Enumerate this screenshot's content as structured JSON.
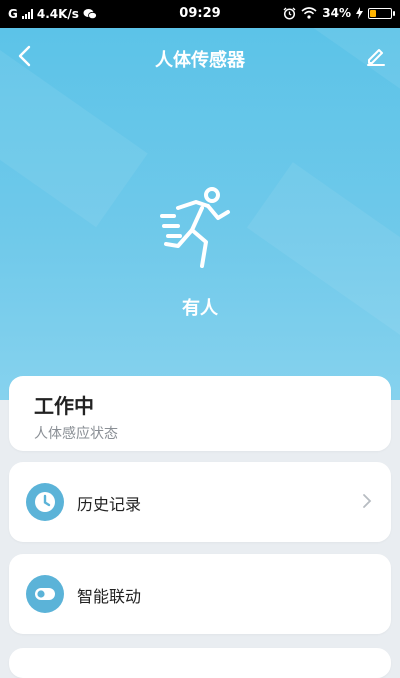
{
  "status_bar": {
    "network": "G",
    "speed": "4.4K/s",
    "time": "09:29",
    "battery": "34%",
    "battery_level": 0.34,
    "icons": [
      "signal-icon",
      "wechat-icon",
      "alarm-icon",
      "wifi-icon",
      "charging-icon",
      "battery-icon"
    ]
  },
  "header": {
    "title": "人体传感器",
    "back_icon": "back-arrow-icon",
    "edit_icon": "edit-pencil-icon"
  },
  "device": {
    "icon": "running-person-icon",
    "state": "有人"
  },
  "status_card": {
    "status": "工作中",
    "description": "人体感应状态"
  },
  "menu": [
    {
      "label": "历史记录",
      "icon": "clock-icon"
    },
    {
      "label": "智能联动",
      "icon": "toggle-icon"
    }
  ],
  "colors": {
    "hero_top": "#5cc3e8",
    "hero_bottom": "#86d2ee",
    "accent": "#5bb3d8",
    "background": "#e9edf1"
  }
}
